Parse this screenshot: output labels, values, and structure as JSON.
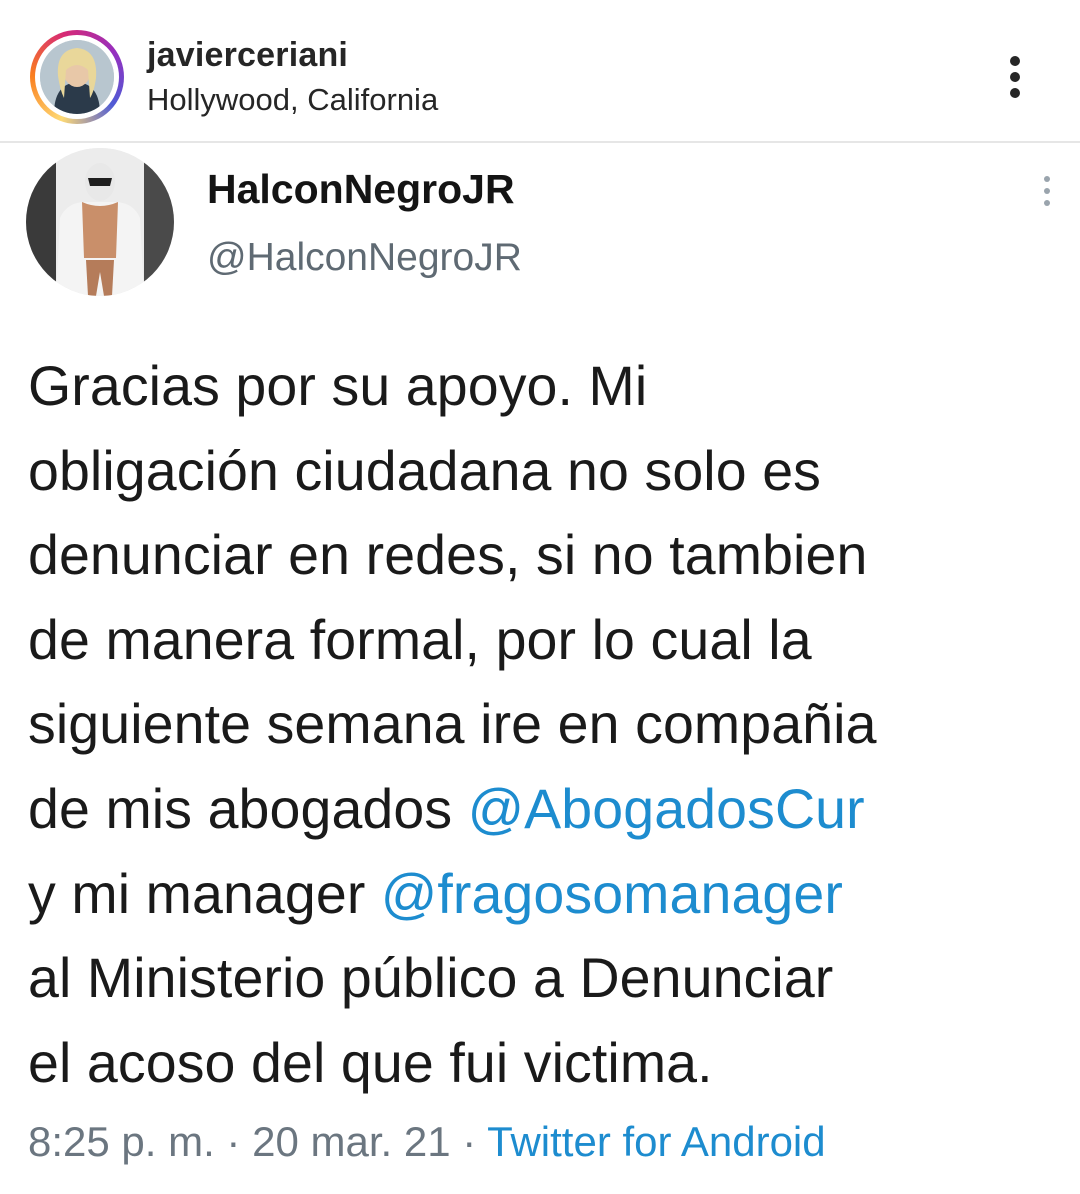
{
  "instagram_post": {
    "username": "javierceriani",
    "location": "Hollywood, California",
    "more_icon": "more-vertical-icon"
  },
  "tweet": {
    "display_name": "HalconNegroJR",
    "handle": "@HalconNegroJR",
    "more_icon": "more-vertical-icon",
    "body": {
      "line1": "Gracias por su apoyo. Mi",
      "line2": "obligación ciudadana no solo es",
      "line3": "denunciar en redes, si no tambien",
      "line4": "de manera formal, por lo cual la",
      "line5": "siguiente semana ire en compañia",
      "line6_pre": "de mis abogados ",
      "mention1": "@AbogadosCur",
      "line7_pre": "y mi manager ",
      "mention2": "@fragosomanager",
      "line8": "al Ministerio público a Denunciar",
      "line9": "el acoso del que fui victima."
    },
    "meta": {
      "time": "8:25 p. m.",
      "separator1": " · ",
      "date": "20 mar. 21",
      "separator2": " · ",
      "source": "Twitter for Android"
    }
  },
  "colors": {
    "link": "#1d8ccf",
    "text": "#1a1a1a",
    "secondary": "#6b7680"
  }
}
